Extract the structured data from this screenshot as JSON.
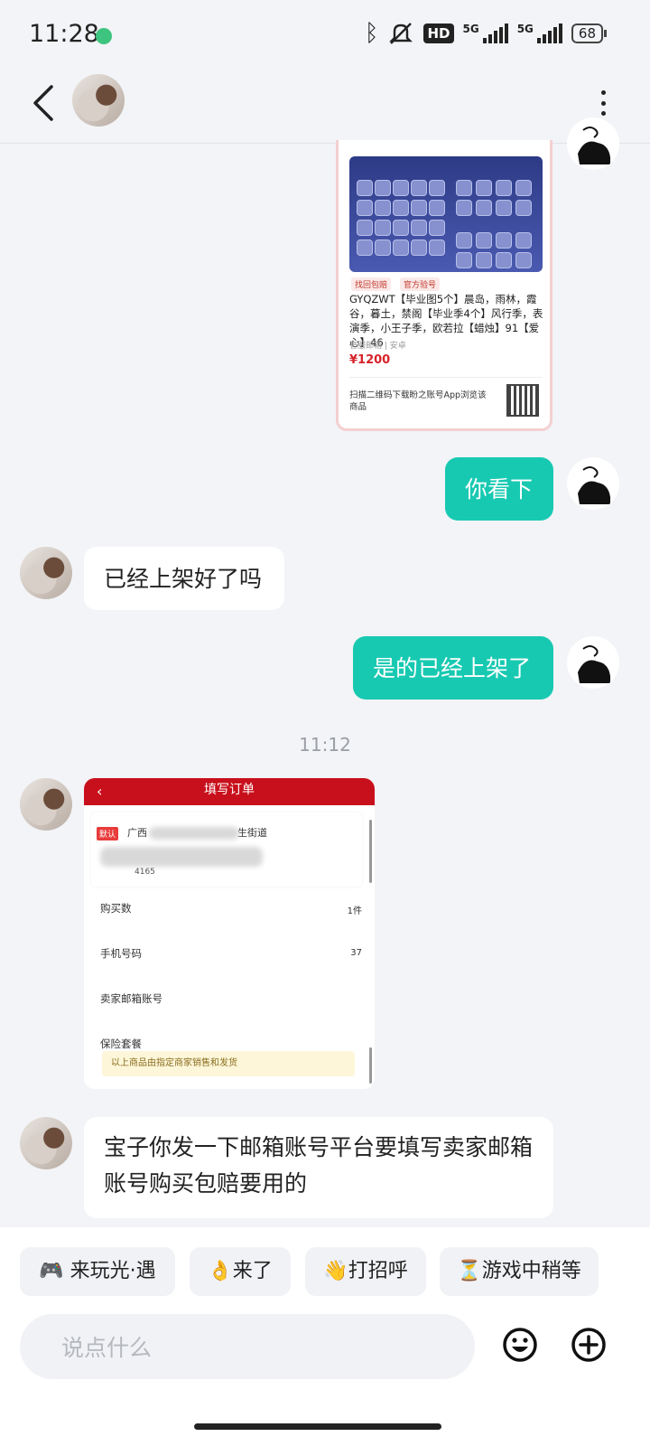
{
  "status_bar": {
    "time": "11:28",
    "hd_label": "HD",
    "net1": "5G",
    "net2": "5G",
    "battery": "68"
  },
  "header": {
    "back_icon": "chevron-left-icon",
    "more_icon": "more-vertical-icon"
  },
  "product_card": {
    "tags": [
      "找回包赔",
      "官方验号"
    ],
    "title": "GYQZWT【毕业图5个】晨岛，雨林，霞谷，暮土，禁阁【毕业季4个】风行季，表演季，小王子季，欧若拉【蜡烛】91【爱心】46",
    "subtitle": "官服邮箱 | 安卓",
    "price": "¥1200",
    "scan_text": "扫描二维码下载盼之账号App浏览该商品"
  },
  "messages": {
    "m1": "你看下",
    "m2": "已经上架好了吗",
    "m3": "是的已经上架了",
    "time": "11:12",
    "m4": "宝子你发一下邮箱账号平台要填写卖家邮箱账号购买包赔要用的"
  },
  "order_card": {
    "title": "填写订单",
    "default_tag": "默认",
    "address_prefix": "广西",
    "address_suffix": "生街道",
    "phone_tail": "4165",
    "qty_label": "购买数",
    "qty_value": "1件",
    "phone_label": "手机号码",
    "phone_value": "37",
    "email_label": "卖家邮箱账号",
    "insurance_label": "保险套餐",
    "notice": "以上商品由指定商家销售和发货"
  },
  "quick_replies": [
    "🎮 来玩光·遇",
    "👌来了",
    "👋打招呼",
    "⏳游戏中稍等"
  ],
  "input": {
    "placeholder": "说点什么"
  },
  "colors": {
    "accent": "#18c9b2",
    "order_red": "#c8101c"
  }
}
